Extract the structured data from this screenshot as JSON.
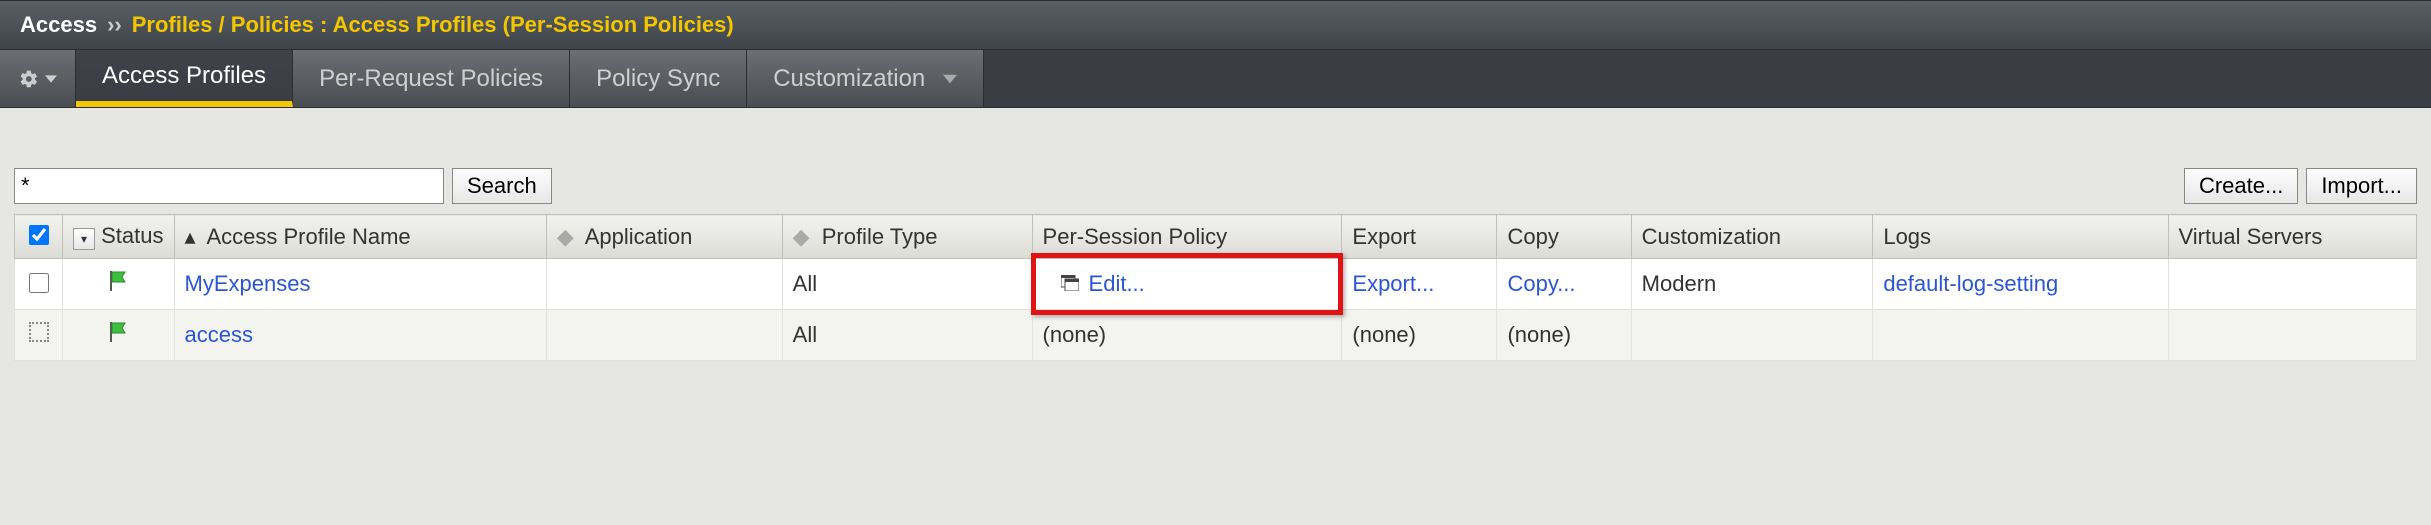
{
  "breadcrumb": {
    "main": "Access",
    "sep": "››",
    "sub": "Profiles / Policies : Access Profiles (Per-Session Policies)"
  },
  "tabs": [
    {
      "label": "Access Profiles",
      "active": true,
      "hasDropdown": false
    },
    {
      "label": "Per-Request Policies",
      "active": false,
      "hasDropdown": false
    },
    {
      "label": "Policy Sync",
      "active": false,
      "hasDropdown": false
    },
    {
      "label": "Customization",
      "active": false,
      "hasDropdown": true
    }
  ],
  "search": {
    "value": "*",
    "button": "Search"
  },
  "buttons": {
    "create": "Create...",
    "import": "Import..."
  },
  "columns": {
    "status": "Status",
    "name": "Access Profile Name",
    "application": "Application",
    "profileType": "Profile Type",
    "perSession": "Per-Session Policy",
    "export": "Export",
    "copy": "Copy",
    "customization": "Customization",
    "logs": "Logs",
    "virtualServers": "Virtual Servers"
  },
  "rows": [
    {
      "checkboxType": "normal",
      "name": "MyExpenses",
      "application": "",
      "profileType": "All",
      "perSession": "Edit...",
      "perSessionLink": true,
      "highlight": true,
      "export": "Export...",
      "exportLink": true,
      "copy": "Copy...",
      "copyLink": true,
      "customization": "Modern",
      "logs": "default-log-setting",
      "logsLink": true,
      "virtualServers": ""
    },
    {
      "checkboxType": "dashed",
      "name": "access",
      "application": "",
      "profileType": "All",
      "perSession": "(none)",
      "perSessionLink": false,
      "highlight": false,
      "export": "(none)",
      "exportLink": false,
      "copy": "(none)",
      "copyLink": false,
      "customization": "",
      "logs": "",
      "logsLink": false,
      "virtualServers": ""
    }
  ]
}
